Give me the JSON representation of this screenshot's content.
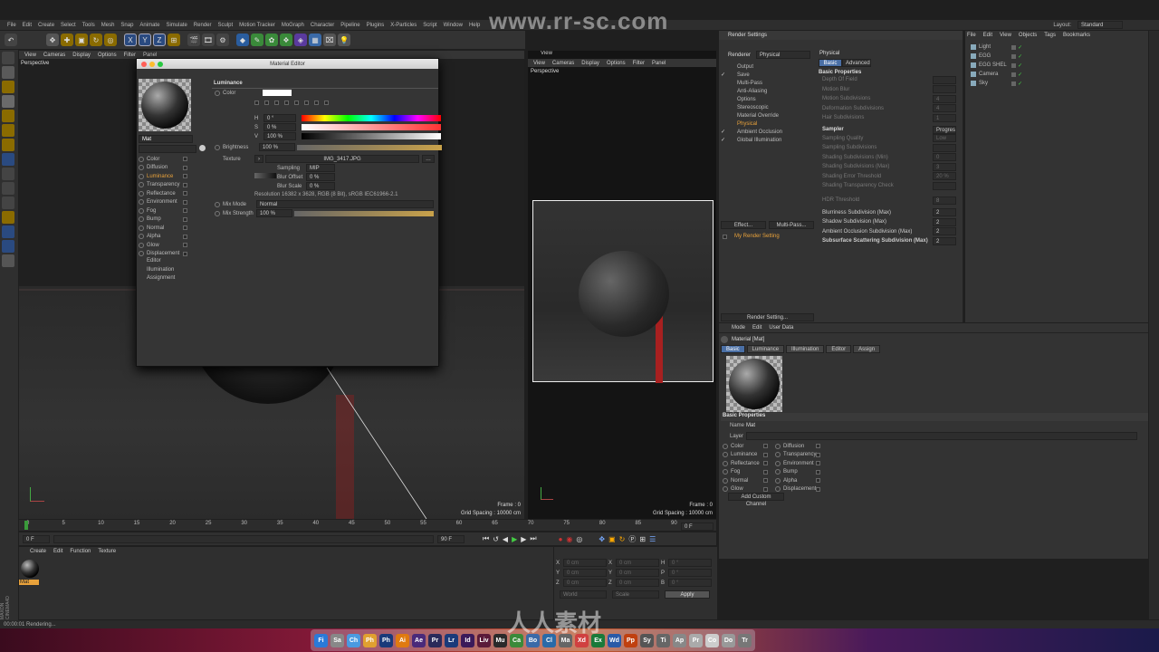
{
  "menubar": {
    "items": [
      "File",
      "Edit",
      "Create",
      "Select",
      "Tools",
      "Mesh",
      "Snap",
      "Animate",
      "Simulate",
      "Render",
      "Sculpt",
      "Motion Tracker",
      "MoGraph",
      "Character",
      "Pipeline",
      "Plugins",
      "X-Particles",
      "Script",
      "Window",
      "Help"
    ],
    "layout_label": "Layout:",
    "layout_value": "Standard"
  },
  "watermark": {
    "top": "www.rr-sc.com",
    "tile": "人人素材社区",
    "bottom": "人人素材"
  },
  "toolbar": {
    "axis": [
      "X",
      "Y",
      "Z"
    ]
  },
  "viewport_left": {
    "menu": [
      "View",
      "Cameras",
      "Display",
      "Options",
      "Filter",
      "Panel"
    ],
    "title": "Perspective",
    "frame": "Frame : 0",
    "grid": "Grid Spacing : 10000 cm"
  },
  "viewport_right": {
    "menu": [
      "View",
      "Cameras",
      "Display",
      "Options",
      "Filter",
      "Panel"
    ],
    "header": "View",
    "title": "Perspective",
    "frame": "Frame : 0",
    "grid": "Grid Spacing : 10000 cm"
  },
  "material_editor": {
    "title": "Material Editor",
    "name": "Mat",
    "channels": [
      {
        "label": "Color",
        "checked": false
      },
      {
        "label": "Diffusion",
        "checked": false
      },
      {
        "label": "Luminance",
        "checked": true
      },
      {
        "label": "Transparency",
        "checked": false
      },
      {
        "label": "Reflectance",
        "checked": false
      },
      {
        "label": "Environment",
        "checked": false
      },
      {
        "label": "Fog",
        "checked": false
      },
      {
        "label": "Bump",
        "checked": false
      },
      {
        "label": "Normal",
        "checked": false
      },
      {
        "label": "Alpha",
        "checked": false
      },
      {
        "label": "Glow",
        "checked": false
      },
      {
        "label": "Displacement",
        "checked": false
      }
    ],
    "extra": [
      "Editor",
      "Illumination",
      "Assignment"
    ],
    "section": "Luminance",
    "color_label": "Color",
    "h_label": "H",
    "h_value": "0 °",
    "s_label": "S",
    "s_value": "0 %",
    "v_label": "V",
    "v_value": "100 %",
    "brightness_label": "Brightness",
    "brightness_value": "100 %",
    "texture_label": "Texture",
    "texture_file": "IMG_3417.JPG",
    "sampling_label": "Sampling",
    "sampling_value": "MIP",
    "blur_offset_label": "Blur Offset",
    "blur_offset_value": "0 %",
    "blur_scale_label": "Blur Scale",
    "blur_scale_value": "0 %",
    "resolution": "Resolution 16382 x 3628, RGB (8 Bit), sRGB IEC61966-2.1",
    "mixmode_label": "Mix Mode",
    "mixmode_value": "Normal",
    "mixstrength_label": "Mix Strength",
    "mixstrength_value": "100 %"
  },
  "render_settings": {
    "title": "Render Settings",
    "renderer_label": "Renderer",
    "renderer_value": "Physical",
    "list": [
      {
        "label": "Output",
        "checked": false,
        "active": false
      },
      {
        "label": "Save",
        "checked": true,
        "active": false
      },
      {
        "label": "Multi-Pass",
        "checked": false,
        "active": false
      },
      {
        "label": "Anti-Aliasing",
        "checked": false,
        "active": false
      },
      {
        "label": "Options",
        "checked": false,
        "active": false
      },
      {
        "label": "Stereoscopic",
        "checked": false,
        "active": false
      },
      {
        "label": "Material Override",
        "checked": false,
        "active": false
      },
      {
        "label": "Physical",
        "checked": false,
        "active": true
      },
      {
        "label": "Ambient Occlusion",
        "checked": true,
        "active": false
      },
      {
        "label": "Global Illumination",
        "checked": true,
        "active": false
      }
    ],
    "effect_btn": "Effect...",
    "multipass_btn": "Multi-Pass...",
    "my_setting": "My Render Setting",
    "render_setting_btn": "Render Setting...",
    "panel_title": "Physical",
    "tabs": [
      "Basic",
      "Advanced"
    ],
    "basic_props": "Basic Properties",
    "props": [
      "Depth Of Field",
      "Motion Blur",
      "Motion Subdivisions",
      "Deformation Subdivisions",
      "Hair Subdivisions"
    ],
    "prop_vals": [
      "",
      "",
      "4",
      "4",
      "1"
    ],
    "sampler_label": "Sampler",
    "sampler_value": "Progres",
    "sampler_props": [
      "Sampling Quality",
      "Sampling Subdivisions",
      "Shading Subdivisions (Min)",
      "Shading Subdivisions (Max)",
      "Shading Error Threshold",
      "Shading Transparency Check"
    ],
    "sampler_vals": [
      "Low",
      "",
      "0",
      "3",
      "20 %",
      ""
    ],
    "hdr_label": "HDR Threshold",
    "hdr_value": "8",
    "subdiv": [
      {
        "label": "Blurriness Subdivision (Max)",
        "value": "2"
      },
      {
        "label": "Shadow Subdivision (Max)",
        "value": "2"
      },
      {
        "label": "Ambient Occlusion Subdivision (Max)",
        "value": "2"
      },
      {
        "label": "Subsurface Scattering Subdivision (Max)",
        "value": "2"
      }
    ]
  },
  "object_manager": {
    "menu": [
      "File",
      "Edit",
      "View",
      "Objects",
      "Tags",
      "Bookmarks"
    ],
    "items": [
      "Light",
      "EGG",
      "EGG SHEL",
      "Camera",
      "Sky"
    ]
  },
  "attributes": {
    "menu": [
      "Mode",
      "Edit",
      "User Data"
    ],
    "header": "Material [Mat]",
    "tabs": [
      "Basic",
      "Luminance",
      "Illumination",
      "Editor",
      "Assign"
    ],
    "basic_props": "Basic Properties",
    "name_label": "Name",
    "name_value": "Mat",
    "layer_label": "Layer",
    "left_channels": [
      "Color",
      "Luminance",
      "Reflectance",
      "Fog",
      "Normal",
      "Glow"
    ],
    "left_checked": [
      false,
      true,
      false,
      false,
      false,
      false
    ],
    "right_channels": [
      "Diffusion",
      "Transparency",
      "Environment",
      "Bump",
      "Alpha",
      "Displacement"
    ],
    "add_btn": "Add Custom Channel"
  },
  "timeline": {
    "ticks": [
      "0",
      "5",
      "10",
      "15",
      "20",
      "25",
      "30",
      "35",
      "40",
      "45",
      "50",
      "55",
      "60",
      "65",
      "70",
      "75",
      "80",
      "85",
      "90"
    ],
    "current": "0 F",
    "start": "0 F",
    "end": "90 F",
    "right_frame": "0 F"
  },
  "material_manager": {
    "menu": [
      "Create",
      "Edit",
      "Function",
      "Texture"
    ],
    "mat_name": "Mat"
  },
  "coords": {
    "rows": [
      {
        "a": "X",
        "av": "0 cm",
        "b": "X",
        "bv": "0 cm",
        "c": "H",
        "cv": "0 °"
      },
      {
        "a": "Y",
        "av": "0 cm",
        "b": "Y",
        "bv": "0 cm",
        "c": "P",
        "cv": "0 °"
      },
      {
        "a": "Z",
        "av": "0 cm",
        "b": "Z",
        "bv": "0 cm",
        "c": "B",
        "cv": "0 °"
      }
    ],
    "world": "World",
    "scale": "Scale",
    "apply": "Apply"
  },
  "status": {
    "text": "00:00:01 Rendering..."
  },
  "brand": "MAXON CINEMA4D",
  "dock": [
    "Fi",
    "Sa",
    "Ch",
    "Ph",
    "Ph",
    "Ai",
    "Ae",
    "Pr",
    "Lr",
    "Id",
    "Liv",
    "Mu",
    "Ca",
    "Bo",
    "Cl",
    "Ma",
    "Xd",
    "Ex",
    "Wd",
    "Pp",
    "Sy",
    "Ti",
    "Ap",
    "Pr",
    "Co",
    "Do",
    "Tr"
  ]
}
